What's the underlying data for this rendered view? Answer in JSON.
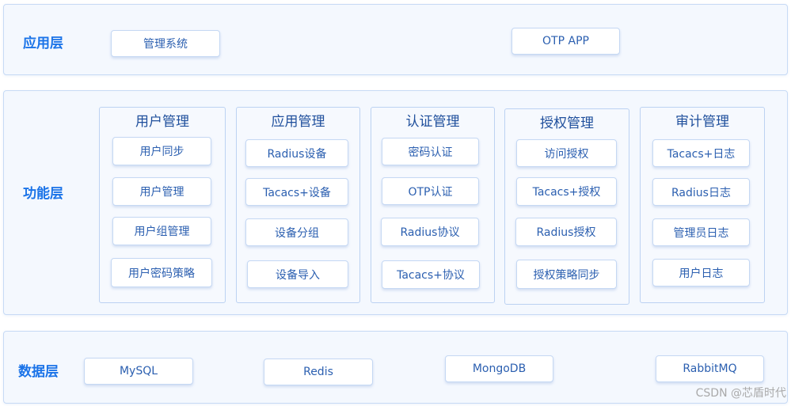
{
  "layers": {
    "application": {
      "label": "应用层",
      "items": [
        "管理系统",
        "OTP APP"
      ]
    },
    "function": {
      "label": "功能层",
      "modules": [
        {
          "title": "用户管理",
          "items": [
            "用户同步",
            "用户管理",
            "用户组管理",
            "用户密码策略"
          ]
        },
        {
          "title": "应用管理",
          "items": [
            "Radius设备",
            "Tacacs+设备",
            "设备分组",
            "设备导入"
          ]
        },
        {
          "title": "认证管理",
          "items": [
            "密码认证",
            "OTP认证",
            "Radius协议",
            "Tacacs+协议"
          ]
        },
        {
          "title": "授权管理",
          "items": [
            "访问授权",
            "Tacacs+授权",
            "Radius授权",
            "授权策略同步"
          ]
        },
        {
          "title": "审计管理",
          "items": [
            "Tacacs+日志",
            "Radius日志",
            "管理员日志",
            "用户日志"
          ]
        }
      ]
    },
    "data": {
      "label": "数据层",
      "items": [
        "MySQL",
        "Redis",
        "MongoDB",
        "RabbitMQ"
      ]
    }
  },
  "watermark": "CSDN @芯盾时代",
  "colors": {
    "accent": "#1a73e8",
    "chip_text": "#2b5fb0",
    "layer_background": "#f4f8fe",
    "border": "#c7daf5"
  }
}
